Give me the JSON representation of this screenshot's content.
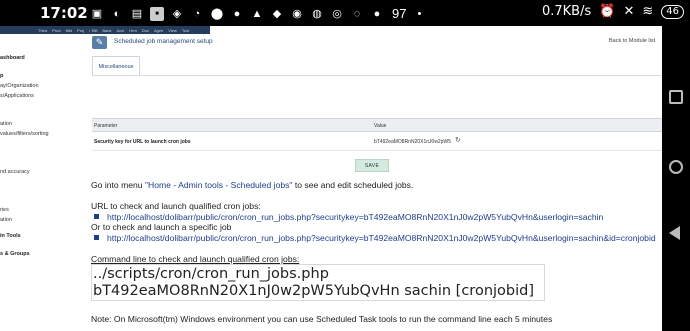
{
  "statusbar": {
    "time": "17:02",
    "speed": "0.7KB/s",
    "battery": "46",
    "notification_count": "97"
  },
  "topmenu": {
    "items": [
      "Third",
      "Prod",
      "Mkt",
      "Proj",
      "Com",
      "Bill",
      "Bank",
      "Acct",
      "Hrm",
      "Doc",
      "Agen",
      "View",
      "Tool"
    ]
  },
  "sidebar": {
    "items": [
      "ashboard",
      "p",
      "ay/Organization",
      "s/Applications",
      "ation",
      "values/filters/sorting",
      "nd accuracy",
      "ries",
      "ation",
      "in Tools",
      "s & Groups"
    ]
  },
  "header": {
    "title": "Scheduled job management setup",
    "back_link": "Back to Module list"
  },
  "tabs": [
    {
      "label": "Miscellaneous"
    }
  ],
  "table": {
    "headers": [
      "Parameter",
      "Value"
    ],
    "rows": [
      {
        "param": "Security key for URL to launch cron jobs",
        "value": "bT492eaMO8RnN20X1nJ0w2pW5"
      }
    ]
  },
  "save_label": "SAVE",
  "content": {
    "intro_prefix": "Go into menu ",
    "intro_link": "\"Home - Admin tools - Scheduled jobs\"",
    "intro_suffix": " to see and edit scheduled jobs.",
    "url_label": "URL to check and launch qualified cron jobs:",
    "url1": "http://localhost/dolibarr/public/cron/cron_run_jobs.php?securitykey=bT492eaMO8RnN20X1nJ0w2pW5YubQvHn&userlogin=sachin",
    "or_label": "Or to check and launch a specific job",
    "url2": "http://localhost/dolibarr/public/cron/cron_run_jobs.php?securitykey=bT492eaMO8RnN20X1nJ0w2pW5YubQvHn&userlogin=sachin&id=cronjobid",
    "cmd_label": "Command line to check and launch qualified cron jobs:",
    "cmd_line1": "../scripts/cron/cron_run_jobs.php",
    "cmd_line2": "bT492eaMO8RnN20X1nJ0w2pW5YubQvHn sachin [cronjobid]",
    "note": "Note: On Microsoft(tm) Windows environment you can use Scheduled Task tools to run the command line each 5 minutes"
  }
}
